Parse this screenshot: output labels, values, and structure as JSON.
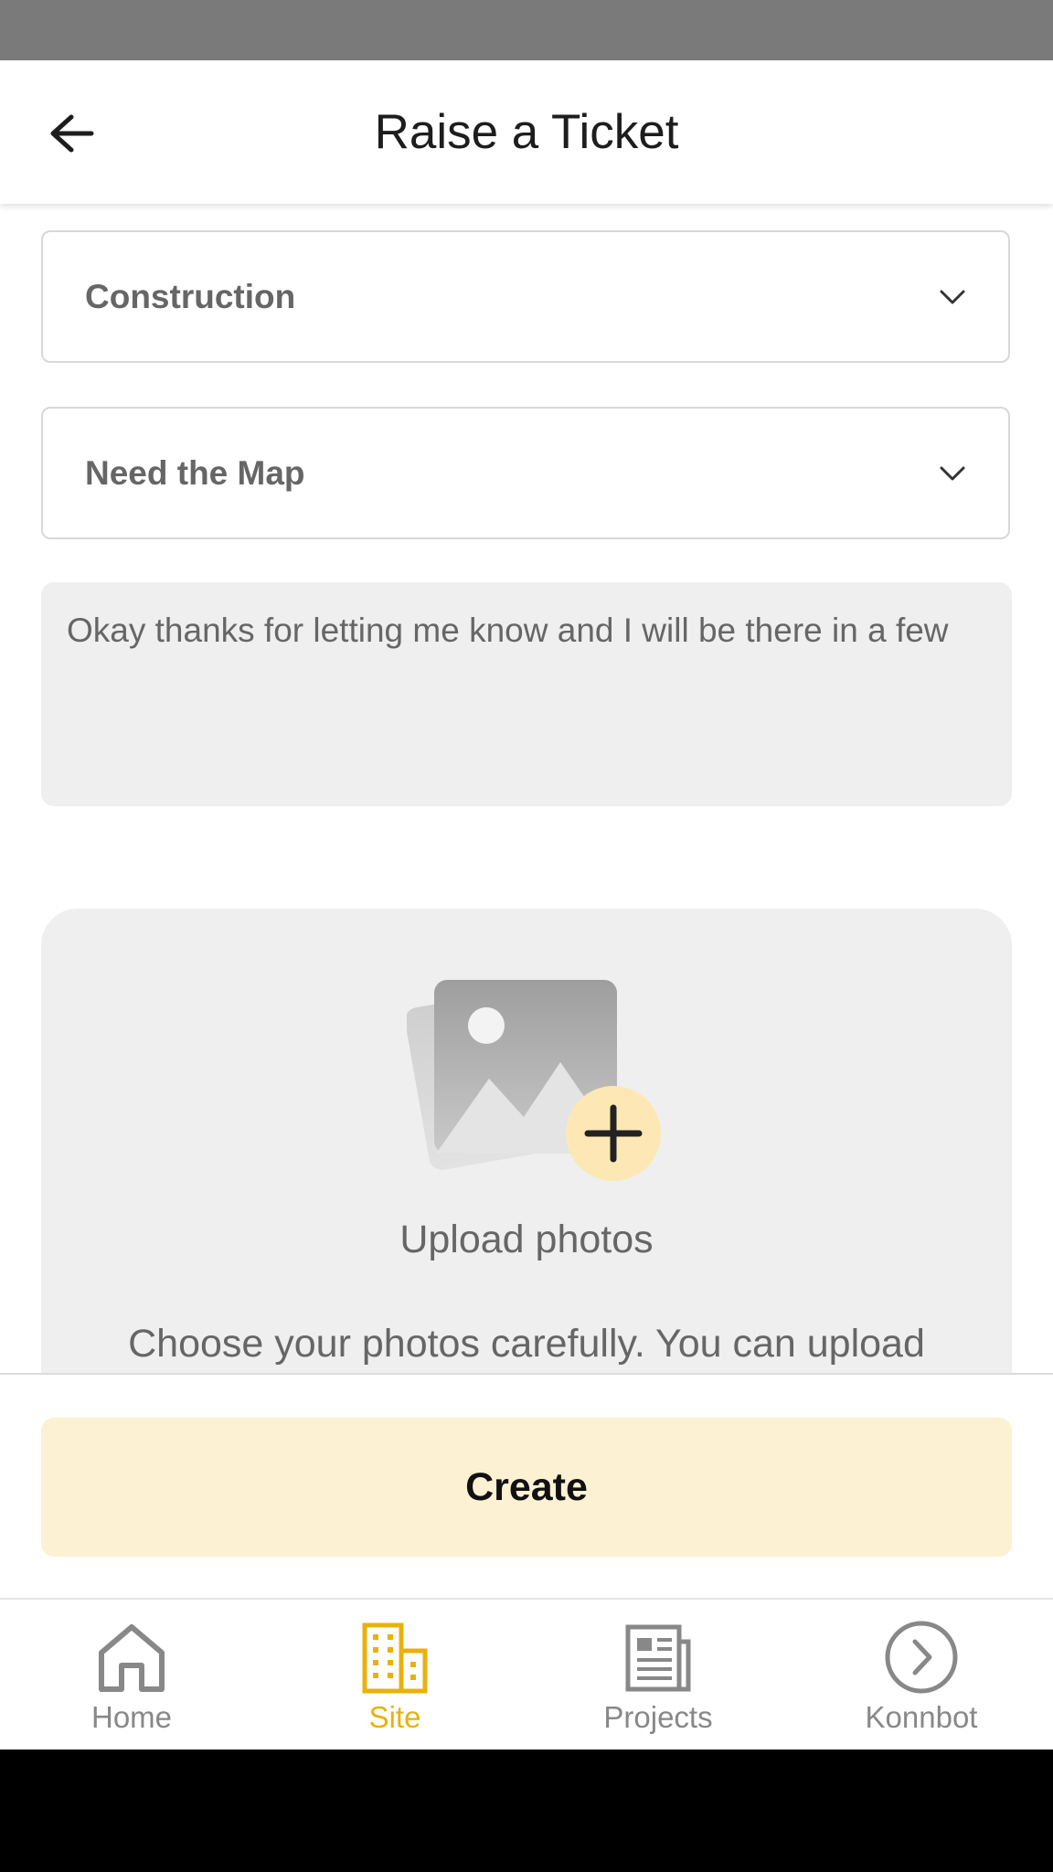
{
  "header": {
    "title": "Raise a Ticket",
    "back_icon": "arrow-left-icon"
  },
  "form": {
    "category_select": {
      "value": "Construction",
      "icon": "chevron-down-icon"
    },
    "subject_select": {
      "value": "Need the Map",
      "icon": "chevron-down-icon"
    },
    "description": {
      "value": "Okay thanks for letting me know and I will be there in a few"
    }
  },
  "upload": {
    "icon": "image-add-icon",
    "title": "Upload photos",
    "hint": "Choose your photos carefully. You can upload"
  },
  "actions": {
    "create_label": "Create",
    "create_color": "#fdf1d3"
  },
  "nav": {
    "active_color": "#e8b20c",
    "items": [
      {
        "label": "Home",
        "icon": "home-icon"
      },
      {
        "label": "Site",
        "icon": "building-icon",
        "active": true
      },
      {
        "label": "Projects",
        "icon": "newspaper-icon"
      },
      {
        "label": "Konnbot",
        "icon": "chevron-right-circle-icon"
      }
    ]
  }
}
